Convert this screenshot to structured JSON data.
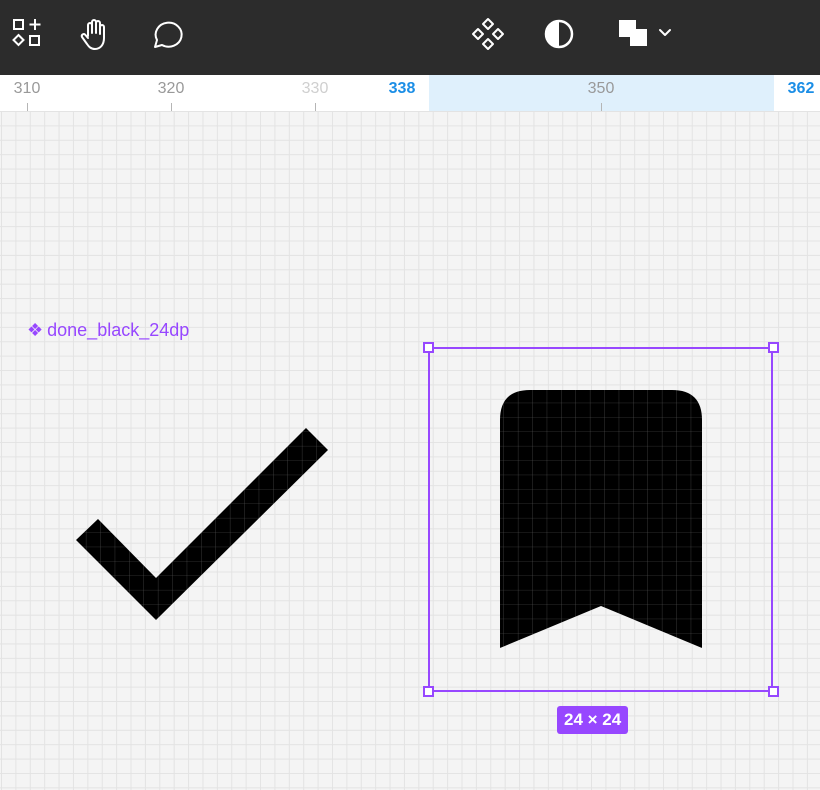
{
  "toolbar": {
    "tools": [
      {
        "name": "shapes-tool",
        "icon": "shapes-icon"
      },
      {
        "name": "hand-tool",
        "icon": "hand-icon"
      },
      {
        "name": "comment-tool",
        "icon": "comment-bubble-icon"
      },
      {
        "name": "component-tool",
        "icon": "component-diamond-icon"
      },
      {
        "name": "contrast-tool",
        "icon": "half-circle-icon"
      },
      {
        "name": "boolean-tool",
        "icon": "boolean-union-icon"
      },
      {
        "name": "dropdown",
        "icon": "chevron-down-icon"
      }
    ]
  },
  "ruler": {
    "labels": [
      "310",
      "320",
      "330",
      "338",
      "350",
      "362"
    ],
    "selection_start": "338",
    "selection_end": "362"
  },
  "canvas": {
    "component_label": "done_black_24dp",
    "component_icon": "component-diamond-icon",
    "left_shape_icon": "checkmark-icon",
    "right_shape_icon": "bookmark-icon",
    "selection_size": "24 × 24"
  },
  "colors": {
    "toolbar_bg": "#2c2c2c",
    "accent_purple": "#9747ff",
    "ruler_accent": "#1b8ee6",
    "selection_ruler_bg": "#dff0fc"
  }
}
